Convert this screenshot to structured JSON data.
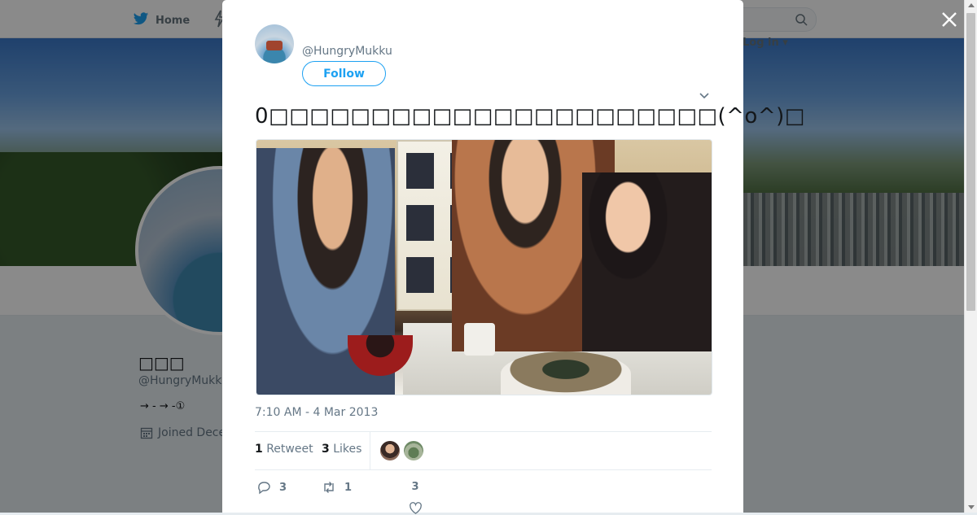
{
  "nav": {
    "home_label": "Home",
    "login_label": "Log in"
  },
  "profile": {
    "name": "□□□",
    "handle": "@HungryMukk",
    "bio": "→ - → -①",
    "joined": "Joined Dece"
  },
  "tweet": {
    "handle": "@HungryMukku",
    "follow_label": "Follow",
    "text": "0□□□□□□□□□□□□□□□□□□□□□□(^o^)□",
    "timestamp": "7:10 AM - 4 Mar 2013",
    "retweet_count": "1",
    "retweet_label": "Retweet",
    "likes_count": "3",
    "likes_label": "Likes",
    "actions": {
      "reply_count": "3",
      "retweet_count": "1",
      "like_count": "3"
    }
  },
  "colors": {
    "accent": "#1da1f2",
    "muted": "#657786",
    "text": "#14171a"
  },
  "icons": [
    "twitter-bird-icon",
    "moments-icon",
    "search-icon",
    "close-icon",
    "chevron-down-icon",
    "reply-icon",
    "retweet-icon",
    "heart-icon",
    "calendar-icon"
  ]
}
